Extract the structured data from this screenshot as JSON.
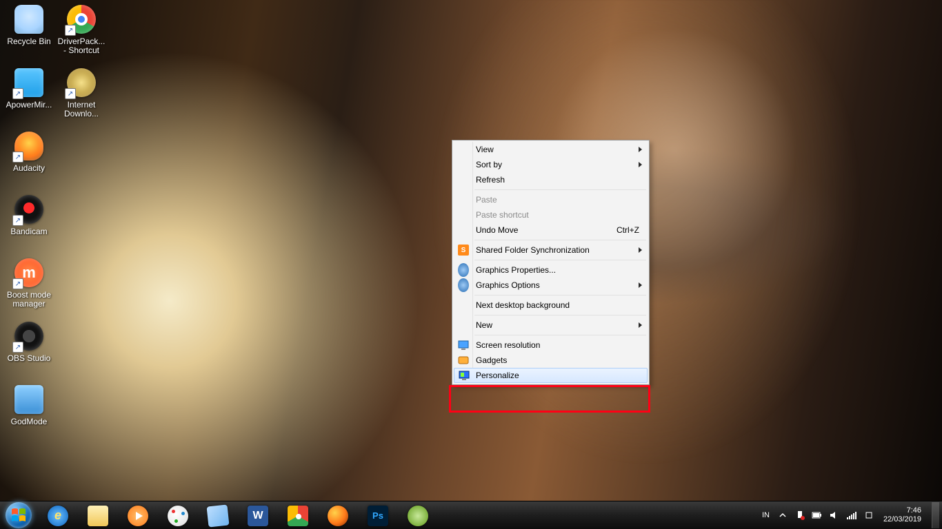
{
  "desktop_icons": [
    {
      "name": "recycle-bin",
      "label": "Recycle Bin",
      "shortcut": false
    },
    {
      "name": "driverpack",
      "label": "DriverPack... - Shortcut",
      "shortcut": true
    },
    {
      "name": "apowermirror",
      "label": "ApowerMir...",
      "shortcut": true
    },
    {
      "name": "idm",
      "label": "Internet Downlo...",
      "shortcut": true
    },
    {
      "name": "audacity",
      "label": "Audacity",
      "shortcut": true
    },
    {
      "name": "bandicam",
      "label": "Bandicam",
      "shortcut": true
    },
    {
      "name": "boost-mode",
      "label": "Boost mode manager",
      "shortcut": true
    },
    {
      "name": "obs-studio",
      "label": "OBS Studio",
      "shortcut": true
    },
    {
      "name": "godmode",
      "label": "GodMode",
      "shortcut": false
    }
  ],
  "context_menu": {
    "view": "View",
    "sort_by": "Sort by",
    "refresh": "Refresh",
    "paste": "Paste",
    "paste_shortcut": "Paste shortcut",
    "undo_move": "Undo Move",
    "undo_move_key": "Ctrl+Z",
    "shared_folder": "Shared Folder Synchronization",
    "gfx_props": "Graphics Properties...",
    "gfx_opts": "Graphics Options",
    "next_bg": "Next desktop background",
    "new": "New",
    "screen_res": "Screen resolution",
    "gadgets": "Gadgets",
    "personalize": "Personalize"
  },
  "taskbar": {
    "pinned": [
      {
        "name": "internet-explorer",
        "color": "#2b7bd9"
      },
      {
        "name": "file-explorer",
        "color": "#f3d27a"
      },
      {
        "name": "windows-media",
        "color": "#ff8c1a"
      },
      {
        "name": "paint",
        "color": "#e6e6e6"
      },
      {
        "name": "sticky-notes",
        "color": "#8fc6ff"
      },
      {
        "name": "word",
        "color": "#2b579a"
      },
      {
        "name": "chrome",
        "color": "chrome"
      },
      {
        "name": "firefox",
        "color": "#ff7139"
      },
      {
        "name": "photoshop",
        "color": "#001e36"
      },
      {
        "name": "coreldraw",
        "color": "#5fa617"
      }
    ]
  },
  "tray": {
    "lang": "IN",
    "time": "7:46",
    "date": "22/03/2019"
  }
}
